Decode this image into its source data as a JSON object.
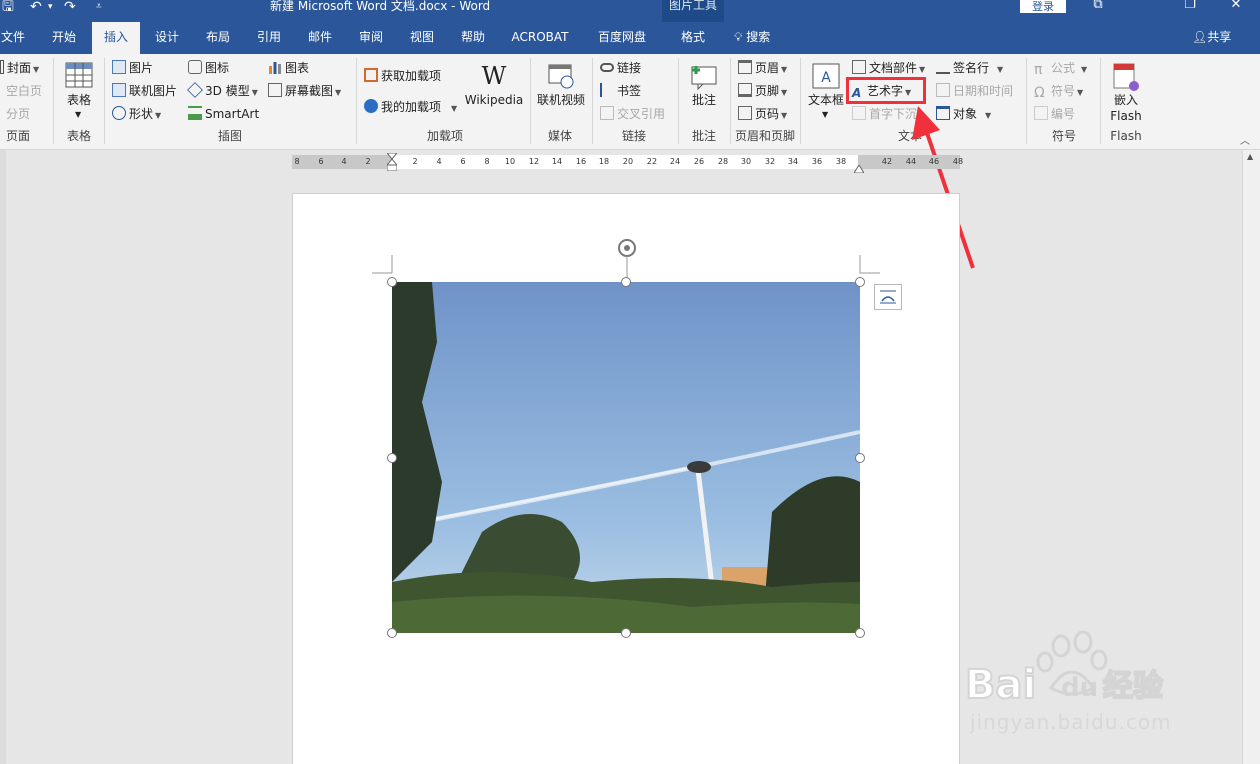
{
  "window": {
    "title": "新建 Microsoft Word 文档.docx  -  Word",
    "context_tab_group": "图片工具",
    "login_label": "登录"
  },
  "tabs": [
    {
      "label": "文件"
    },
    {
      "label": "开始"
    },
    {
      "label": "插入",
      "active": true
    },
    {
      "label": "设计"
    },
    {
      "label": "布局"
    },
    {
      "label": "引用"
    },
    {
      "label": "邮件"
    },
    {
      "label": "审阅"
    },
    {
      "label": "视图"
    },
    {
      "label": "帮助"
    },
    {
      "label": "ACROBAT"
    },
    {
      "label": "百度网盘"
    },
    {
      "label": "格式"
    }
  ],
  "search_label": "搜索",
  "share_label": "共享",
  "ribbon": {
    "pages": {
      "label": "页面",
      "items": [
        "封面",
        "空白页",
        "分页"
      ]
    },
    "table": {
      "label": "表格",
      "button": "表格"
    },
    "illustrations": {
      "label": "插图",
      "items": [
        "图片",
        "联机图片",
        "形状",
        "图标",
        "3D 模型",
        "SmartArt",
        "图表",
        "屏幕截图"
      ]
    },
    "addins": {
      "label": "加载项",
      "items": [
        "获取加载项",
        "我的加载项"
      ],
      "wikipedia": "Wikipedia",
      "wiki_glyph": "W"
    },
    "media": {
      "label": "媒体",
      "button": "联机视频"
    },
    "links": {
      "label": "链接",
      "items": [
        "链接",
        "书签",
        "交叉引用"
      ]
    },
    "comments": {
      "label": "批注",
      "button": "批注"
    },
    "header_footer": {
      "label": "页眉和页脚",
      "items": [
        "页眉",
        "页脚",
        "页码"
      ]
    },
    "text": {
      "label": "文本",
      "textbox": "文本框",
      "items": [
        "文档部件",
        "艺术字",
        "首字下沉",
        "签名行",
        "日期和时间",
        "对象"
      ]
    },
    "symbols": {
      "label": "符号",
      "items": [
        "公式",
        "符号",
        "编号"
      ]
    },
    "flash": {
      "label": "Flash",
      "button_line1": "嵌入",
      "button_line2": "Flash"
    }
  },
  "ruler_ticks": [
    "8",
    "6",
    "4",
    "2",
    "2",
    "4",
    "6",
    "8",
    "10",
    "12",
    "14",
    "16",
    "18",
    "20",
    "22",
    "24",
    "26",
    "28",
    "30",
    "32",
    "34",
    "36",
    "38",
    "42",
    "44",
    "46",
    "48"
  ],
  "watermark": {
    "brand": "Bai",
    "brand2": "du",
    "cn": "经验",
    "url": "jingyan.baidu.com"
  },
  "colors": {
    "accent": "#2b579a",
    "highlight": "#f0303a"
  }
}
